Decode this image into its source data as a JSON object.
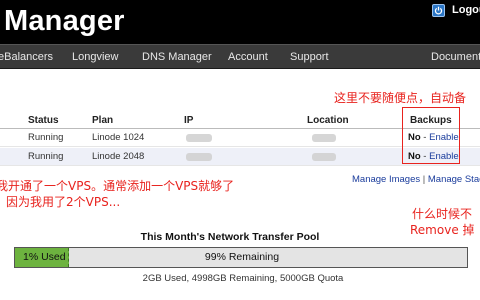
{
  "header": {
    "brand": "Manager",
    "user_label": "Logout"
  },
  "nav": {
    "items": [
      "eBalancers",
      "Longview",
      "DNS Manager",
      "Account",
      "Support",
      "Documentat"
    ]
  },
  "annotations": {
    "top_right": "这里不要随便点，自动备",
    "left_line1": "我开通了一个VPS。通常添加一个VPS就够了",
    "left_line2": "因为我用了2个VPS...",
    "right_line1": "什么时候不",
    "right_line2": "Remove 掉"
  },
  "table": {
    "headers": {
      "status": "Status",
      "plan": "Plan",
      "ip": "IP",
      "location": "Location",
      "backups": "Backups"
    },
    "rows": [
      {
        "status": "Running",
        "plan": "Linode 1024",
        "backups_state": "No",
        "backups_sep": " - ",
        "backups_action": "Enable"
      },
      {
        "status": "Running",
        "plan": "Linode 2048",
        "backups_state": "No",
        "backups_sep": " - ",
        "backups_action": "Enable"
      }
    ]
  },
  "links": {
    "manage_images": "Manage Images",
    "separator": " | ",
    "manage_stack": "Manage Stack"
  },
  "transfer_pool": {
    "title": "This Month's Network Transfer Pool",
    "used_label": "1% Used",
    "used_fraction": 0.0063,
    "remaining_label": "99% Remaining",
    "summary": "2GB Used, 4998GB Remaining, 5000GB Quota"
  },
  "colors": {
    "header_bg": "#000000",
    "nav_bg": "#3a3a3a",
    "annotation": "#e8231e",
    "link": "#1a3c9c",
    "bar_fill": "#6db33f",
    "power_button": "#2b76c6"
  }
}
